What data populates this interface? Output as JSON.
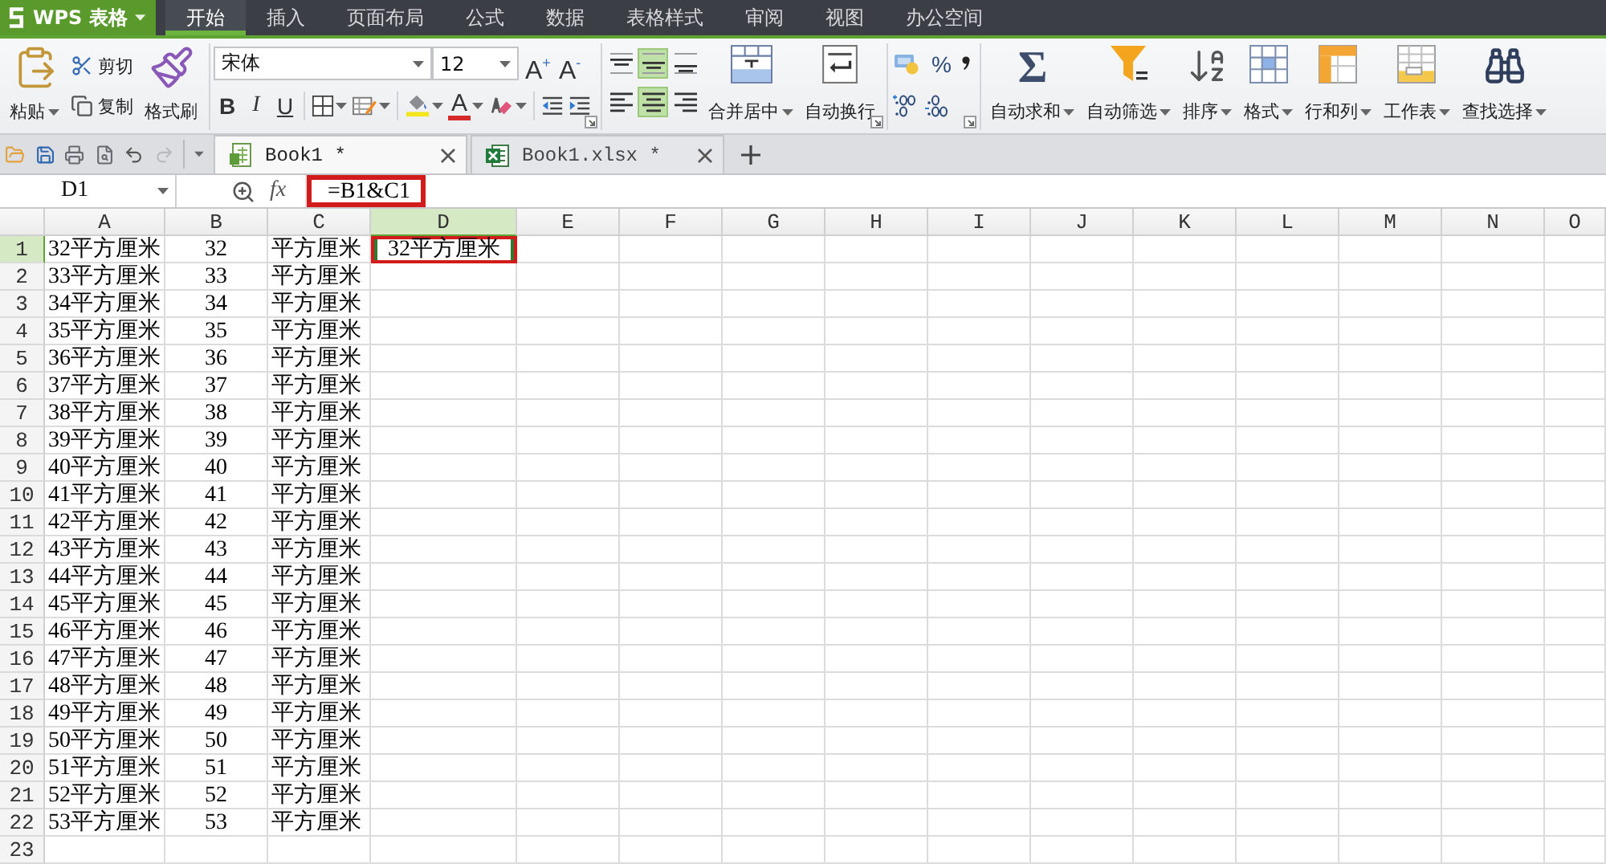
{
  "app_button": {
    "label": "WPS 表格"
  },
  "menu_tabs": [
    {
      "label": "开始",
      "selected": true
    },
    {
      "label": "插入",
      "selected": false
    },
    {
      "label": "页面布局",
      "selected": false
    },
    {
      "label": "公式",
      "selected": false
    },
    {
      "label": "数据",
      "selected": false
    },
    {
      "label": "表格样式",
      "selected": false
    },
    {
      "label": "审阅",
      "selected": false
    },
    {
      "label": "视图",
      "selected": false
    },
    {
      "label": "办公空间",
      "selected": false
    }
  ],
  "ribbon": {
    "clipboard": {
      "paste": "粘贴",
      "cut": "剪切",
      "copy": "复制",
      "format_painter": "格式刷"
    },
    "font": {
      "name": "宋体",
      "size": "12",
      "grow": "A$^{+}$",
      "shrink": "A$^{-}$",
      "styles": [
        {
          "label": "B",
          "kind": "bold"
        },
        {
          "label": "I",
          "kind": "italic"
        },
        {
          "label": "U",
          "kind": "underline"
        }
      ],
      "font_color_label": "A"
    },
    "alignment": {
      "buttons": [
        {
          "kind": "top",
          "selected": false
        },
        {
          "kind": "middle",
          "selected": true
        },
        {
          "kind": "bottom",
          "selected": false
        },
        {
          "kind": "left",
          "selected": false
        },
        {
          "kind": "center",
          "selected": true
        },
        {
          "kind": "right",
          "selected": false
        }
      ],
      "merge": "合并居中",
      "wrap": "自动换行"
    },
    "number": {
      "percent": "%"
    },
    "tools": [
      {
        "label": "自动求和",
        "kind": "sum",
        "symbol": "Σ"
      },
      {
        "label": "自动筛选",
        "kind": "filter"
      },
      {
        "label": "排序",
        "kind": "sort"
      },
      {
        "label": "格式",
        "kind": "format"
      },
      {
        "label": "行和列",
        "kind": "rows_cols"
      },
      {
        "label": "工作表",
        "kind": "worksheet"
      },
      {
        "label": "查找选择",
        "kind": "find"
      }
    ]
  },
  "quick_access": [
    {
      "kind": "open",
      "disabled": false
    },
    {
      "kind": "save",
      "disabled": false
    },
    {
      "kind": "print",
      "disabled": false
    },
    {
      "kind": "preview",
      "disabled": false
    },
    {
      "kind": "undo",
      "disabled": false
    },
    {
      "kind": "redo",
      "disabled": true
    }
  ],
  "doc_tabs": [
    {
      "label": "Book1 *",
      "kind": "workbook",
      "selected": true
    },
    {
      "label": "Book1.xlsx *",
      "kind": "xlsx",
      "selected": false
    }
  ],
  "formula_bar": {
    "cell_name": "D1",
    "function_label": "fx",
    "formula": "=B1&C1",
    "highlighted": true
  },
  "sheet": {
    "selection_highlighted": true,
    "columns": [
      {
        "label": "A",
        "selected": false,
        "centered": false
      },
      {
        "label": "B",
        "selected": false,
        "centered": true
      },
      {
        "label": "C",
        "selected": false,
        "centered": false
      },
      {
        "label": "D",
        "selected": true,
        "centered": true
      },
      {
        "label": "E",
        "selected": false
      },
      {
        "label": "F",
        "selected": false
      },
      {
        "label": "G",
        "selected": false
      },
      {
        "label": "H",
        "selected": false
      },
      {
        "label": "I",
        "selected": false
      },
      {
        "label": "J",
        "selected": false
      },
      {
        "label": "K",
        "selected": false
      },
      {
        "label": "L",
        "selected": false
      },
      {
        "label": "M",
        "selected": false
      },
      {
        "label": "N",
        "selected": false
      },
      {
        "label": "O",
        "selected": false
      }
    ],
    "rows": [
      {
        "number": "1",
        "selected": true,
        "cells": [
          "32平方厘米",
          "32",
          "平方厘米",
          "32平方厘米"
        ]
      },
      {
        "number": "2",
        "selected": false,
        "cells": [
          "33平方厘米",
          "33",
          "平方厘米"
        ]
      },
      {
        "number": "3",
        "selected": false,
        "cells": [
          "34平方厘米",
          "34",
          "平方厘米"
        ]
      },
      {
        "number": "4",
        "selected": false,
        "cells": [
          "35平方厘米",
          "35",
          "平方厘米"
        ]
      },
      {
        "number": "5",
        "selected": false,
        "cells": [
          "36平方厘米",
          "36",
          "平方厘米"
        ]
      },
      {
        "number": "6",
        "selected": false,
        "cells": [
          "37平方厘米",
          "37",
          "平方厘米"
        ]
      },
      {
        "number": "7",
        "selected": false,
        "cells": [
          "38平方厘米",
          "38",
          "平方厘米"
        ]
      },
      {
        "number": "8",
        "selected": false,
        "cells": [
          "39平方厘米",
          "39",
          "平方厘米"
        ]
      },
      {
        "number": "9",
        "selected": false,
        "cells": [
          "40平方厘米",
          "40",
          "平方厘米"
        ]
      },
      {
        "number": "10",
        "selected": false,
        "cells": [
          "41平方厘米",
          "41",
          "平方厘米"
        ]
      },
      {
        "number": "11",
        "selected": false,
        "cells": [
          "42平方厘米",
          "42",
          "平方厘米"
        ]
      },
      {
        "number": "12",
        "selected": false,
        "cells": [
          "43平方厘米",
          "43",
          "平方厘米"
        ]
      },
      {
        "number": "13",
        "selected": false,
        "cells": [
          "44平方厘米",
          "44",
          "平方厘米"
        ]
      },
      {
        "number": "14",
        "selected": false,
        "cells": [
          "45平方厘米",
          "45",
          "平方厘米"
        ]
      },
      {
        "number": "15",
        "selected": false,
        "cells": [
          "46平方厘米",
          "46",
          "平方厘米"
        ]
      },
      {
        "number": "16",
        "selected": false,
        "cells": [
          "47平方厘米",
          "47",
          "平方厘米"
        ]
      },
      {
        "number": "17",
        "selected": false,
        "cells": [
          "48平方厘米",
          "48",
          "平方厘米"
        ]
      },
      {
        "number": "18",
        "selected": false,
        "cells": [
          "49平方厘米",
          "49",
          "平方厘米"
        ]
      },
      {
        "number": "19",
        "selected": false,
        "cells": [
          "50平方厘米",
          "50",
          "平方厘米"
        ]
      },
      {
        "number": "20",
        "selected": false,
        "cells": [
          "51平方厘米",
          "51",
          "平方厘米"
        ]
      },
      {
        "number": "21",
        "selected": false,
        "cells": [
          "52平方厘米",
          "52",
          "平方厘米"
        ]
      },
      {
        "number": "22",
        "selected": false,
        "cells": [
          "53平方厘米",
          "53",
          "平方厘米"
        ]
      },
      {
        "number": "23",
        "selected": false
      }
    ]
  }
}
